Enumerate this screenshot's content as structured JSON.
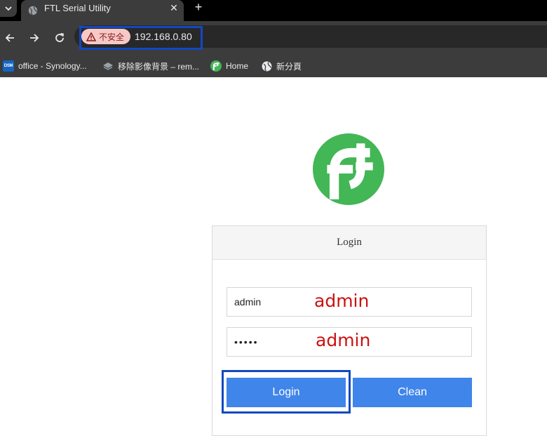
{
  "browser": {
    "tab": {
      "title": "FTL Serial Utility"
    },
    "new_tab_symbol": "+",
    "close_symbol": "✕",
    "address": {
      "security_label": "不安全",
      "url": "192.168.0.80"
    },
    "bookmarks": [
      {
        "label": "office - Synology...",
        "icon": "dsm-icon",
        "icon_text": "DSM"
      },
      {
        "label": "移除影像背景 – rem...",
        "icon": "layers-icon"
      },
      {
        "label": "Home",
        "icon": "ftl-logo-icon"
      },
      {
        "label": "新分頁",
        "icon": "globe-icon"
      }
    ]
  },
  "page": {
    "login": {
      "title": "Login",
      "username_value": "admin",
      "password_value": "admin",
      "login_button": "Login",
      "clean_button": "Clean"
    },
    "annotations": {
      "username_hint": "admin",
      "password_hint": "admin"
    }
  },
  "colors": {
    "brand_green": "#43b656",
    "button_blue": "#4085e9",
    "highlight_blue": "#1248c2",
    "annotation_red": "#cc1111"
  }
}
